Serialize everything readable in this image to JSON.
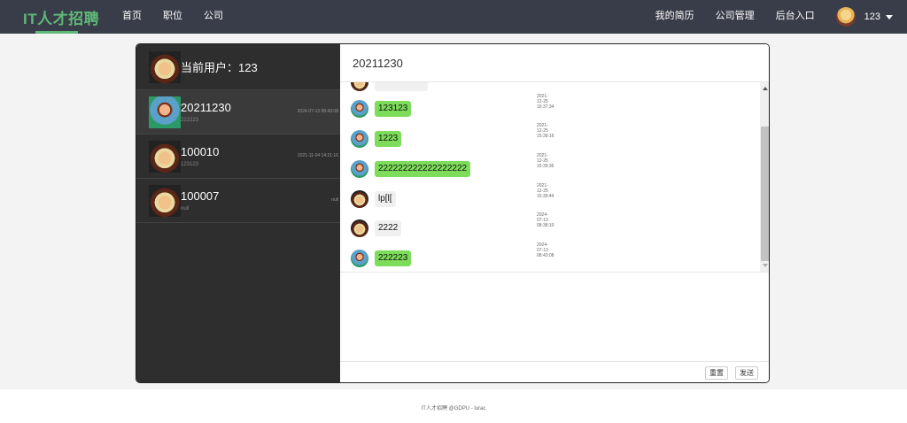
{
  "navbar": {
    "brand": "IT人才招聘",
    "left_items": [
      "首页",
      "职位",
      "公司"
    ],
    "right_items": [
      "我的简历",
      "公司管理",
      "后台入口"
    ],
    "username": "123"
  },
  "sidebar": {
    "current_user_label": "当前用户：123",
    "contacts": [
      {
        "name": "20211230",
        "last_message": "222223",
        "time": "2024-07-13 08:43:08"
      },
      {
        "name": "100010",
        "last_message": "123123",
        "time": "2021-11-04 14:21:16"
      },
      {
        "name": "100007",
        "last_message": "null",
        "time": "null"
      }
    ]
  },
  "chat": {
    "title": "20211230",
    "messages": [
      {
        "time": "2021-12-25 15:37:34",
        "text": "123123",
        "from": "me"
      },
      {
        "time": "2021-12-25 15:39:16",
        "text": "1223",
        "from": "me"
      },
      {
        "time": "2021-12-25 15:39:36",
        "text": "222222222222222222",
        "from": "me"
      },
      {
        "time": "2021-12-25 15:39:44",
        "text": "lp[l[",
        "from": "other"
      },
      {
        "time": "2024-07-13 08:38:10",
        "text": "2222",
        "from": "other"
      },
      {
        "time": "2024-07-13 08:43:08",
        "text": "222223",
        "from": "me"
      }
    ],
    "reset_label": "重置",
    "send_label": "发送"
  },
  "footer": {
    "text": "IT人才招聘 @GDPU - lurac"
  },
  "colors": {
    "brand": "#5fb878",
    "navbar": "#393d49",
    "bubble_me": "#7ddc5a",
    "sidebar": "#2e2e2e"
  }
}
